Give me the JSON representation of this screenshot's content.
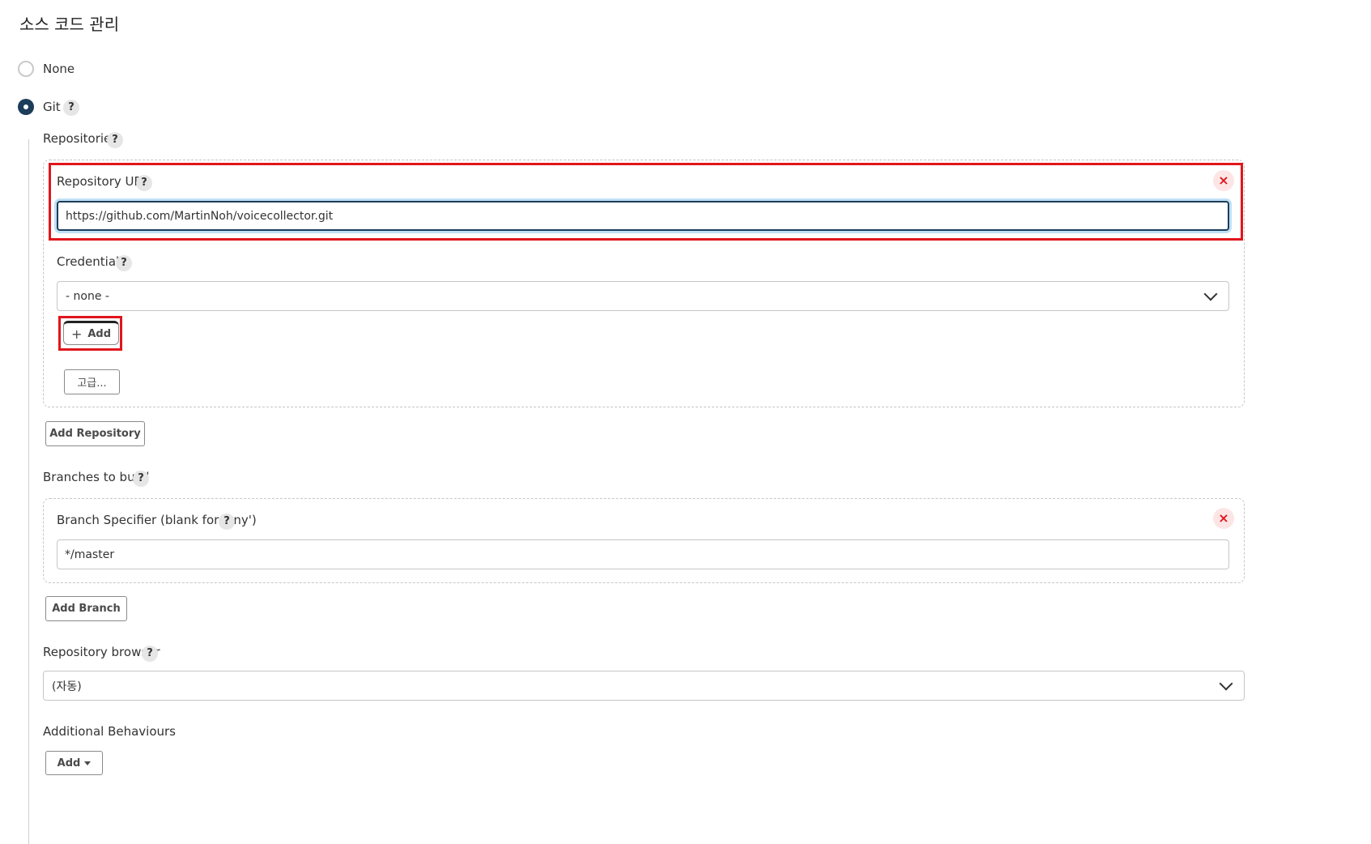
{
  "section_title": "소스 코드 관리",
  "scm_options": [
    {
      "label": "None",
      "selected": false
    },
    {
      "label": "Git",
      "selected": true
    }
  ],
  "help_symbol": "?",
  "repositories": {
    "label": "Repositories",
    "url_label": "Repository URL",
    "url_value": "https://github.com/MartinNoh/voicecollector.git",
    "credentials_label": "Credentials",
    "credentials_value": "- none -",
    "add_label": "Add",
    "advanced_label": "고급...",
    "add_repository_label": "Add Repository",
    "remove_symbol": "×"
  },
  "branches": {
    "label": "Branches to build",
    "specifier_label": "Branch Specifier (blank for 'any')",
    "specifier_value": "*/master",
    "add_branch_label": "Add Branch",
    "remove_symbol": "×"
  },
  "repository_browser": {
    "label": "Repository browser",
    "value": "(자동)"
  },
  "additional_behaviours": {
    "label": "Additional Behaviours",
    "add_label": "Add"
  },
  "colors": {
    "accent": "#1c3d5a",
    "highlight": "#e0161c",
    "focus_ring": "#bfe0f6"
  }
}
